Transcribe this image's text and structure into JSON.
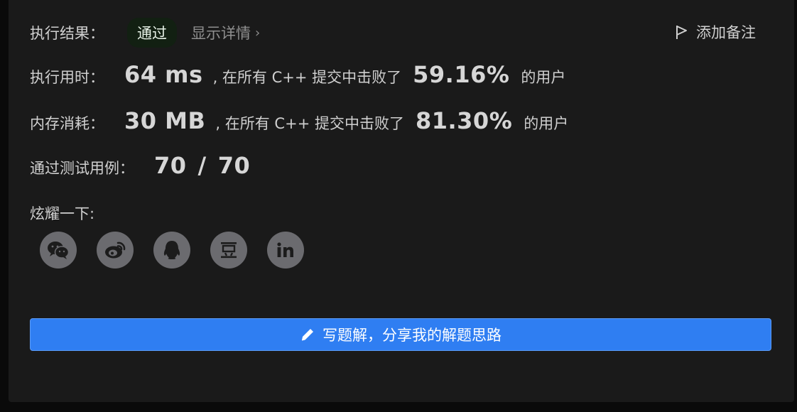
{
  "result": {
    "label": "执行结果：",
    "status": "通过",
    "detail_link": "显示详情",
    "add_note": "添加备注"
  },
  "runtime": {
    "label": "执行用时：",
    "value": "64 ms",
    "beat_text": ", 在所有 C++ 提交中击败了",
    "percent": "59.16%",
    "suffix": "的用户"
  },
  "memory": {
    "label": "内存消耗：",
    "value": "30 MB",
    "beat_text": ", 在所有 C++ 提交中击败了",
    "percent": "81.30%",
    "suffix": "的用户"
  },
  "testcases": {
    "label": "通过测试用例：",
    "passed": "70",
    "separator": "/",
    "total": "70"
  },
  "share": {
    "label": "炫耀一下:",
    "icons": [
      "wechat-icon",
      "weibo-icon",
      "qq-icon",
      "douban-icon",
      "linkedin-icon"
    ]
  },
  "write_solution": {
    "label": "写题解，分享我的解题思路"
  },
  "colors": {
    "primary": "#2f7ef2",
    "panel": "#1a1a1a",
    "success_bg": "#122012",
    "icon_circle": "#6b6b6f"
  }
}
